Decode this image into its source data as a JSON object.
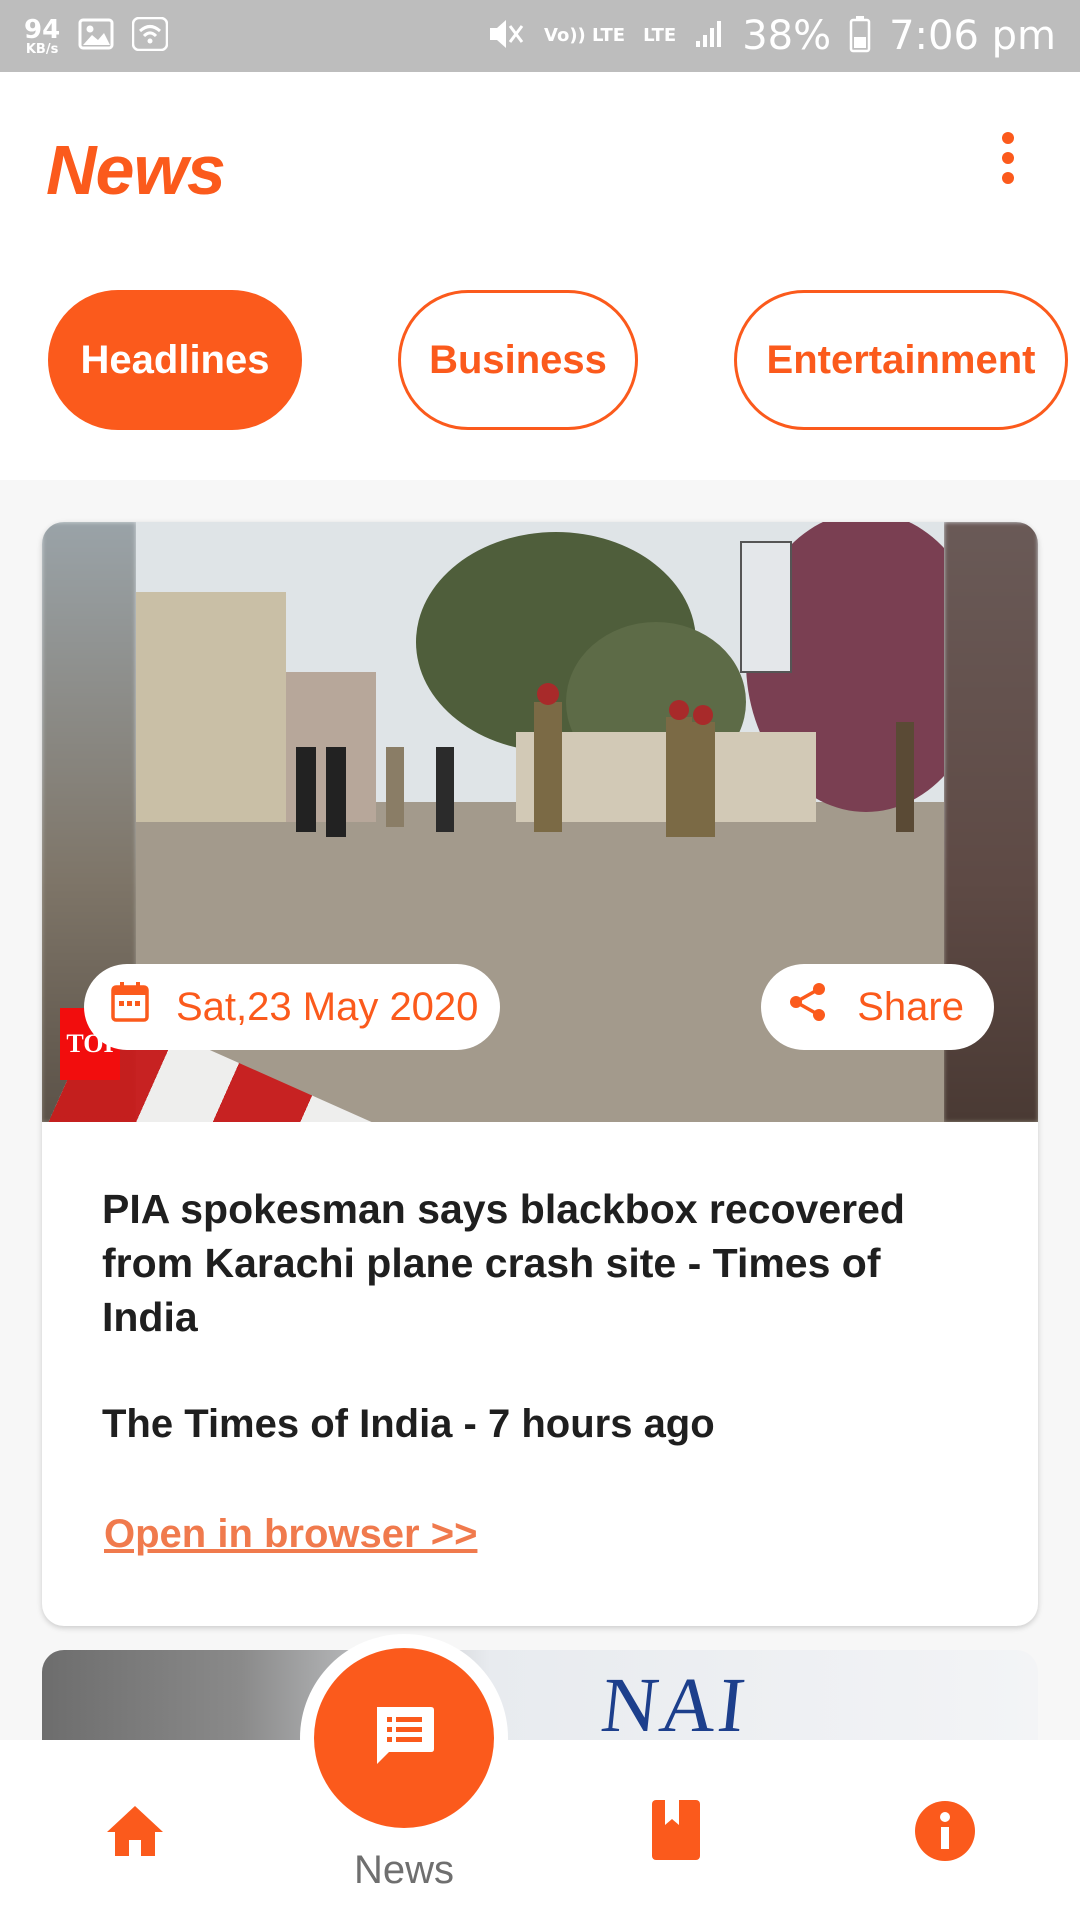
{
  "status_bar": {
    "net_speed_value": "94",
    "net_speed_unit": "KB/s",
    "volte": "Vo)) LTE",
    "lte": "LTE",
    "battery": "38%",
    "time": "7:06 pm"
  },
  "header": {
    "title": "News",
    "menu_icon": "more-vert-icon"
  },
  "tabs": [
    {
      "label": "Headlines",
      "active": true
    },
    {
      "label": "Business",
      "active": false
    },
    {
      "label": "Entertainment",
      "active": false
    }
  ],
  "card": {
    "image_logo": "TOI",
    "date": "Sat,23 May 2020",
    "share_label": "Share",
    "title": "PIA spokesman says blackbox recovered from Karachi plane crash site - Times of India",
    "source": "The Times of India - 7 hours ago",
    "link": "Open in browser >>"
  },
  "card2": {
    "image_text": "NAI"
  },
  "bottom_nav": {
    "items": [
      {
        "icon": "home-icon",
        "label": ""
      },
      {
        "icon": "news-feed-icon",
        "label": "News"
      },
      {
        "icon": "bookmark-icon",
        "label": ""
      },
      {
        "icon": "info-icon",
        "label": ""
      }
    ]
  },
  "colors": {
    "accent": "#fb5a1c",
    "status_bar": "#bdbdbd",
    "link": "#f07a4d"
  }
}
